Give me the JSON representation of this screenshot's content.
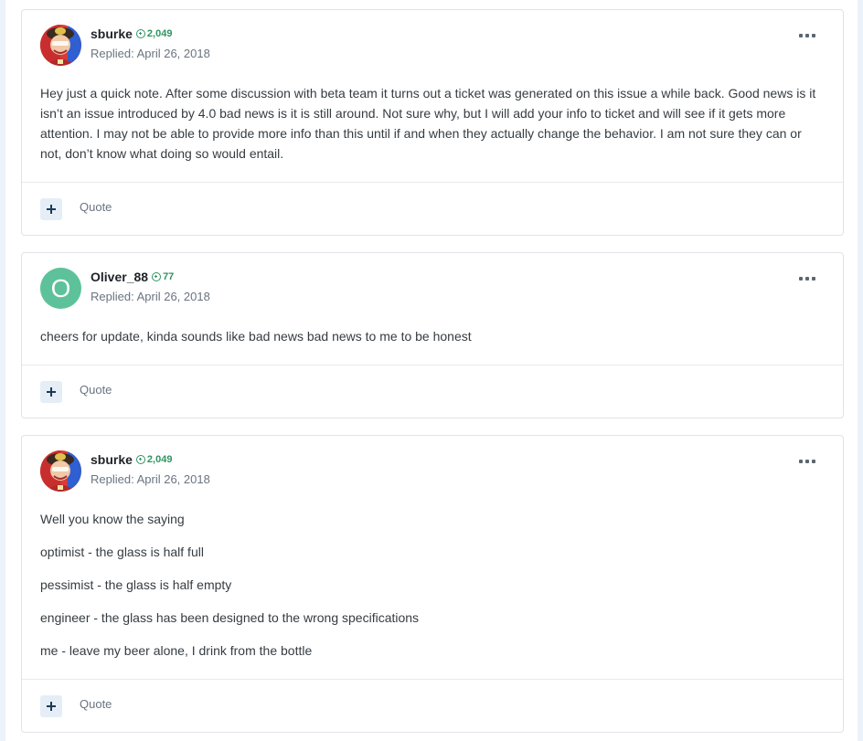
{
  "posts": [
    {
      "author": "sburke",
      "reputation": "2,049",
      "date": "Replied: April 26, 2018",
      "avatar_icon": "sburke-portrait-avatar",
      "paragraphs": [
        "Hey just a quick note. After some discussion with beta team it turns out a ticket was generated on this issue a while back. Good news is it isn’t an issue introduced by 4.0 bad news is it is still around. Not sure why, but I will add your info to ticket and will see if it gets more attention.  I may not be able to provide more info than this until if and when they actually change the behavior.  I am not sure they can or not, don’t know what doing so would entail."
      ],
      "quote_label": "Quote"
    },
    {
      "author": "Oliver_88",
      "reputation": "77",
      "date": "Replied: April 26, 2018",
      "avatar_letter": "O",
      "avatar_color": "#5dc29a",
      "paragraphs": [
        "cheers for update, kinda sounds like bad news bad news to me to be honest"
      ],
      "quote_label": "Quote"
    },
    {
      "author": "sburke",
      "reputation": "2,049",
      "date": "Replied: April 26, 2018",
      "avatar_icon": "sburke-portrait-avatar",
      "paragraphs": [
        "Well you know the saying",
        "optimist - the glass is half full",
        "pessimist - the glass is half empty",
        "engineer - the glass has been designed to the wrong specifications",
        "me - leave my beer alone, I drink from the bottle"
      ],
      "quote_label": "Quote"
    }
  ],
  "colors": {
    "reputation": "#2f9463",
    "page_background": "#ebf2f9",
    "border": "#dfe3e8"
  }
}
